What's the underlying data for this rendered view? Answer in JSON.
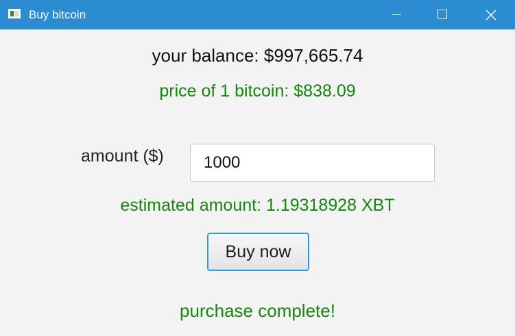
{
  "window": {
    "title": "Buy bitcoin"
  },
  "balance_text": "your balance: $997,665.74",
  "price_text": "price of 1 bitcoin: $838.09",
  "amount": {
    "label": "amount ($)",
    "value": "1000"
  },
  "estimate_text": "estimated amount: 1.19318928 XBT",
  "buy_button_label": "Buy now",
  "status_text": "purchase complete!",
  "colors": {
    "titlebar": "#2b8cd1",
    "success_green": "#16860f",
    "button_focus_border": "#2d9be0",
    "background": "#f3f3f3"
  },
  "icons": {
    "app": "app-window-icon",
    "minimize": "minimize-icon",
    "maximize": "maximize-icon",
    "close": "close-icon"
  }
}
